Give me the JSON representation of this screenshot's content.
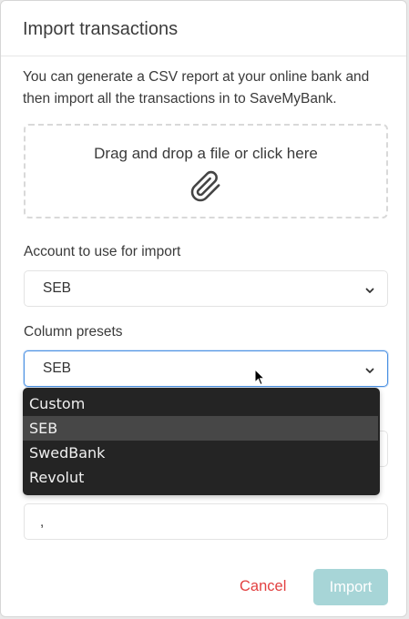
{
  "modal": {
    "title": "Import transactions",
    "description": "You can generate a CSV report at your online bank and then import all the transactions in to SaveMyBank."
  },
  "dropzone": {
    "text": "Drag and drop a file or click here",
    "icon": "paperclip-icon"
  },
  "account_select": {
    "label": "Account to use for import",
    "value": "SEB"
  },
  "preset_select": {
    "label": "Column presets",
    "value": "SEB",
    "options": [
      "Custom",
      "SEB",
      "SwedBank",
      "Revolut"
    ],
    "selected_index": 1
  },
  "delimiter_field": {
    "value": ","
  },
  "actions": {
    "cancel_label": "Cancel",
    "import_label": "Import"
  },
  "colors": {
    "cancel": "#e24040",
    "import_bg": "#a7d5d7",
    "focus_border": "#4a90e2",
    "dropdown_bg": "#242424"
  }
}
